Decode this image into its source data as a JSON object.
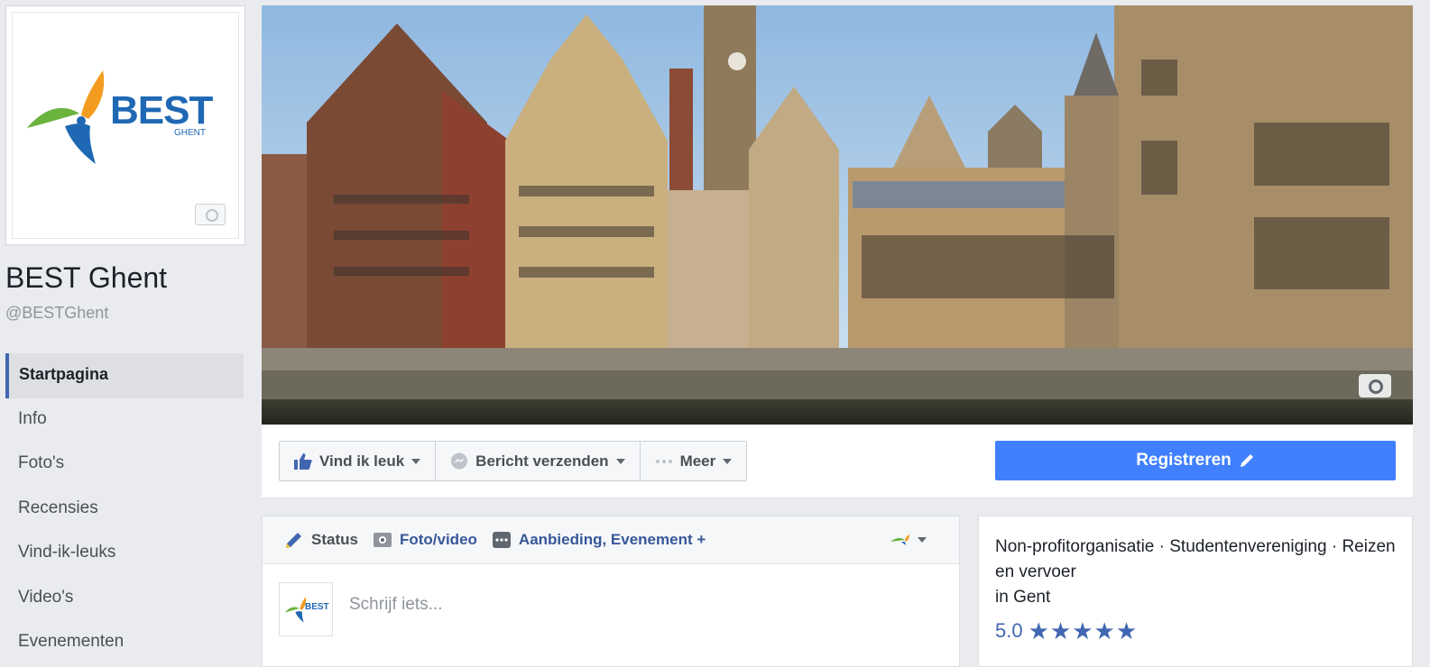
{
  "page": {
    "name": "BEST Ghent",
    "handle": "@BESTGhent"
  },
  "logo": {
    "text": "BEST",
    "subtext": "GHENT",
    "colors": {
      "blue": "#1f68b4",
      "green": "#6ab43e",
      "orange": "#f39c1f"
    }
  },
  "nav": {
    "items": [
      {
        "label": "Startpagina",
        "active": true
      },
      {
        "label": "Info"
      },
      {
        "label": "Foto's"
      },
      {
        "label": "Recensies"
      },
      {
        "label": "Vind-ik-leuks"
      },
      {
        "label": "Video's"
      },
      {
        "label": "Evenementen"
      }
    ]
  },
  "actions": {
    "like_label": "Vind ik leuk",
    "message_label": "Bericht verzenden",
    "more_label": "Meer",
    "register_label": "Registreren"
  },
  "composer": {
    "tabs": [
      {
        "label": "Status",
        "icon": "pencil-icon"
      },
      {
        "label": "Foto/video",
        "icon": "camera-icon"
      },
      {
        "label": "Aanbieding, Evenement +",
        "icon": "more-icon"
      }
    ],
    "placeholder": "Schrijf iets...",
    "avatar_text": "BEST"
  },
  "about": {
    "categories": "Non-profitorganisatie · Studentenvereniging · Reizen en vervoer",
    "location": "in Gent",
    "rating": "5.0",
    "stars": 5
  },
  "colors": {
    "accent": "#4267b2",
    "register_button": "#4080ff",
    "background": "#e9ebee"
  }
}
